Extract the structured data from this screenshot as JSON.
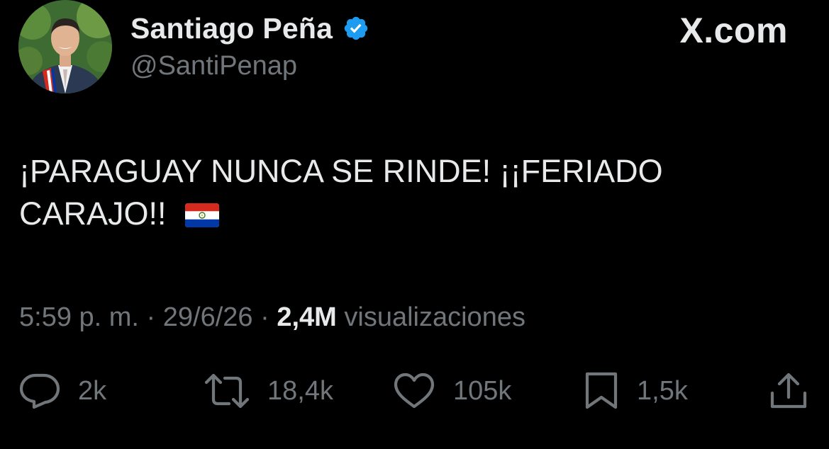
{
  "author": {
    "name": "Santiago Peña",
    "handle": "@SantiPenap",
    "verified_icon": "verified-badge-icon",
    "verified_color": "#1d9bf0"
  },
  "brand": {
    "label": "X.com"
  },
  "tweet": {
    "text_line1": "¡PARAGUAY NUNCA SE RINDE! ¡¡FERIADO",
    "text_line2": "CARAJO!!",
    "emoji": "paraguay-flag-emoji"
  },
  "meta": {
    "time": "5:59 p. m.",
    "separator": "·",
    "date": "29/6/26",
    "views_count": "2,4M",
    "views_label": "visualizaciones"
  },
  "actions": {
    "reply": {
      "icon": "reply-icon",
      "count": "2k"
    },
    "repost": {
      "icon": "repost-icon",
      "count": "18,4k"
    },
    "like": {
      "icon": "heart-icon",
      "count": "105k"
    },
    "bookmark": {
      "icon": "bookmark-icon",
      "count": "1,5k"
    },
    "share": {
      "icon": "share-icon"
    }
  },
  "colors": {
    "background": "#000000",
    "primary_text": "#e7e9ea",
    "secondary_text": "#71767b"
  }
}
